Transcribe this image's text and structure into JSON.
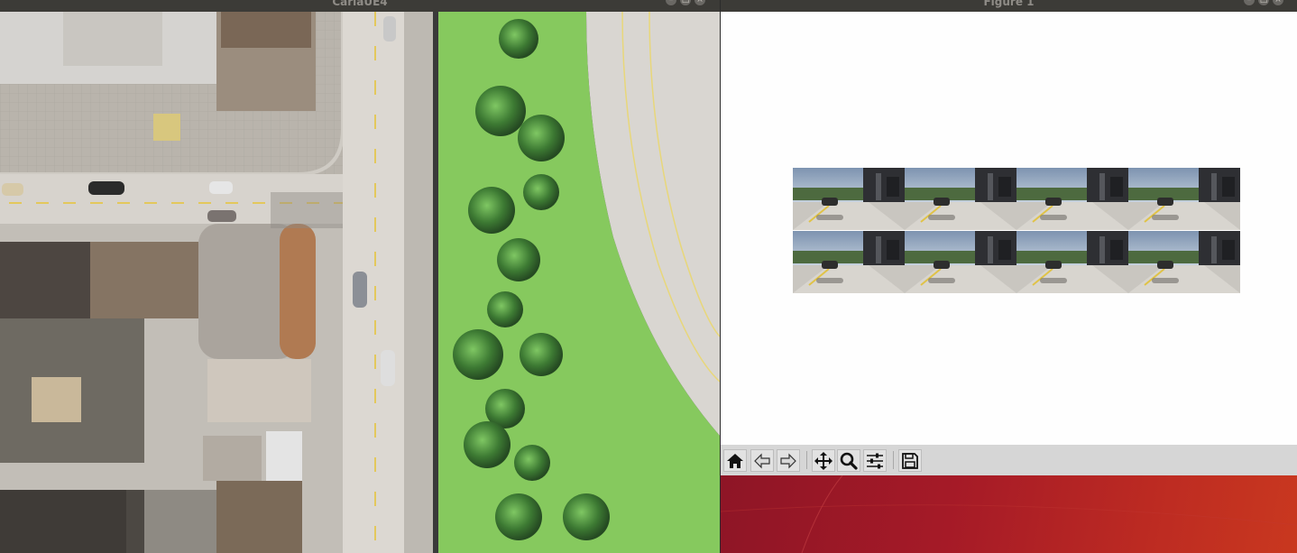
{
  "carla_window": {
    "title": "CarlaUE4",
    "controls": [
      "–",
      "□",
      "×"
    ]
  },
  "figure_window": {
    "title": "Figure 1",
    "controls": [
      "–",
      "□",
      "×"
    ],
    "image_grid": {
      "rows": 2,
      "columns": 4
    },
    "toolbar": [
      {
        "name": "home-button",
        "icon": "home-icon",
        "tooltip": "Home"
      },
      {
        "name": "back-button",
        "icon": "arrow-left-icon",
        "tooltip": "Back"
      },
      {
        "name": "forward-button",
        "icon": "arrow-right-icon",
        "tooltip": "Forward"
      },
      {
        "name": "pan-button",
        "icon": "move-icon",
        "tooltip": "Pan"
      },
      {
        "name": "zoom-button",
        "icon": "magnifier-icon",
        "tooltip": "Zoom"
      },
      {
        "name": "configure-subplots-button",
        "icon": "sliders-icon",
        "tooltip": "Subplots"
      },
      {
        "name": "save-button",
        "icon": "floppy-disk-icon",
        "tooltip": "Save"
      }
    ]
  },
  "colors": {
    "titlebar": "#3c3b37",
    "toolbar": "#d6d6d6",
    "desktop_red": "#a51a27",
    "grass": "#86c95e",
    "road": "#d9d6d1"
  }
}
